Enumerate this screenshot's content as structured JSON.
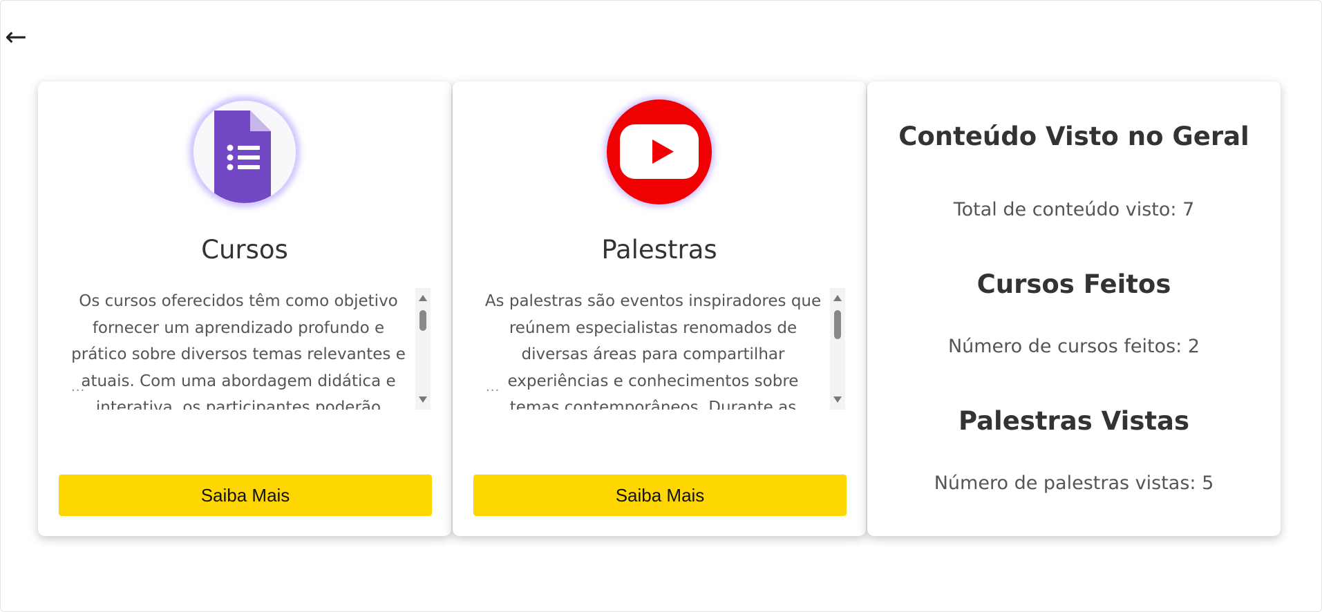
{
  "nav": {
    "back_icon": "←"
  },
  "cards": [
    {
      "icon": "google-forms-icon",
      "title": "Cursos",
      "description": "Os cursos oferecidos têm como objetivo fornecer um aprendizado profundo e prático sobre diversos temas relevantes e atuais. Com uma abordagem didática e interativa, os participantes poderão",
      "ellipsis": "...",
      "button_label": "Saiba Mais"
    },
    {
      "icon": "youtube-icon",
      "title": "Palestras",
      "description": "As palestras são eventos inspiradores que reúnem especialistas renomados de diversas áreas para compartilhar experiências e conhecimentos sobre temas contemporâneos. Durante as",
      "ellipsis": "...",
      "button_label": "Saiba Mais"
    }
  ],
  "stats": {
    "overall_heading": "Conteúdo Visto no Geral",
    "overall_text": "Total de conteúdo visto: 7",
    "courses_heading": "Cursos Feitos",
    "courses_text": "Número de cursos feitos: 2",
    "talks_heading": "Palestras Vistas",
    "talks_text": "Número de palestras vistas: 5"
  },
  "colors": {
    "button_bg": "#ffd700",
    "youtube_red": "#f00000",
    "forms_purple": "#6f42c1"
  }
}
